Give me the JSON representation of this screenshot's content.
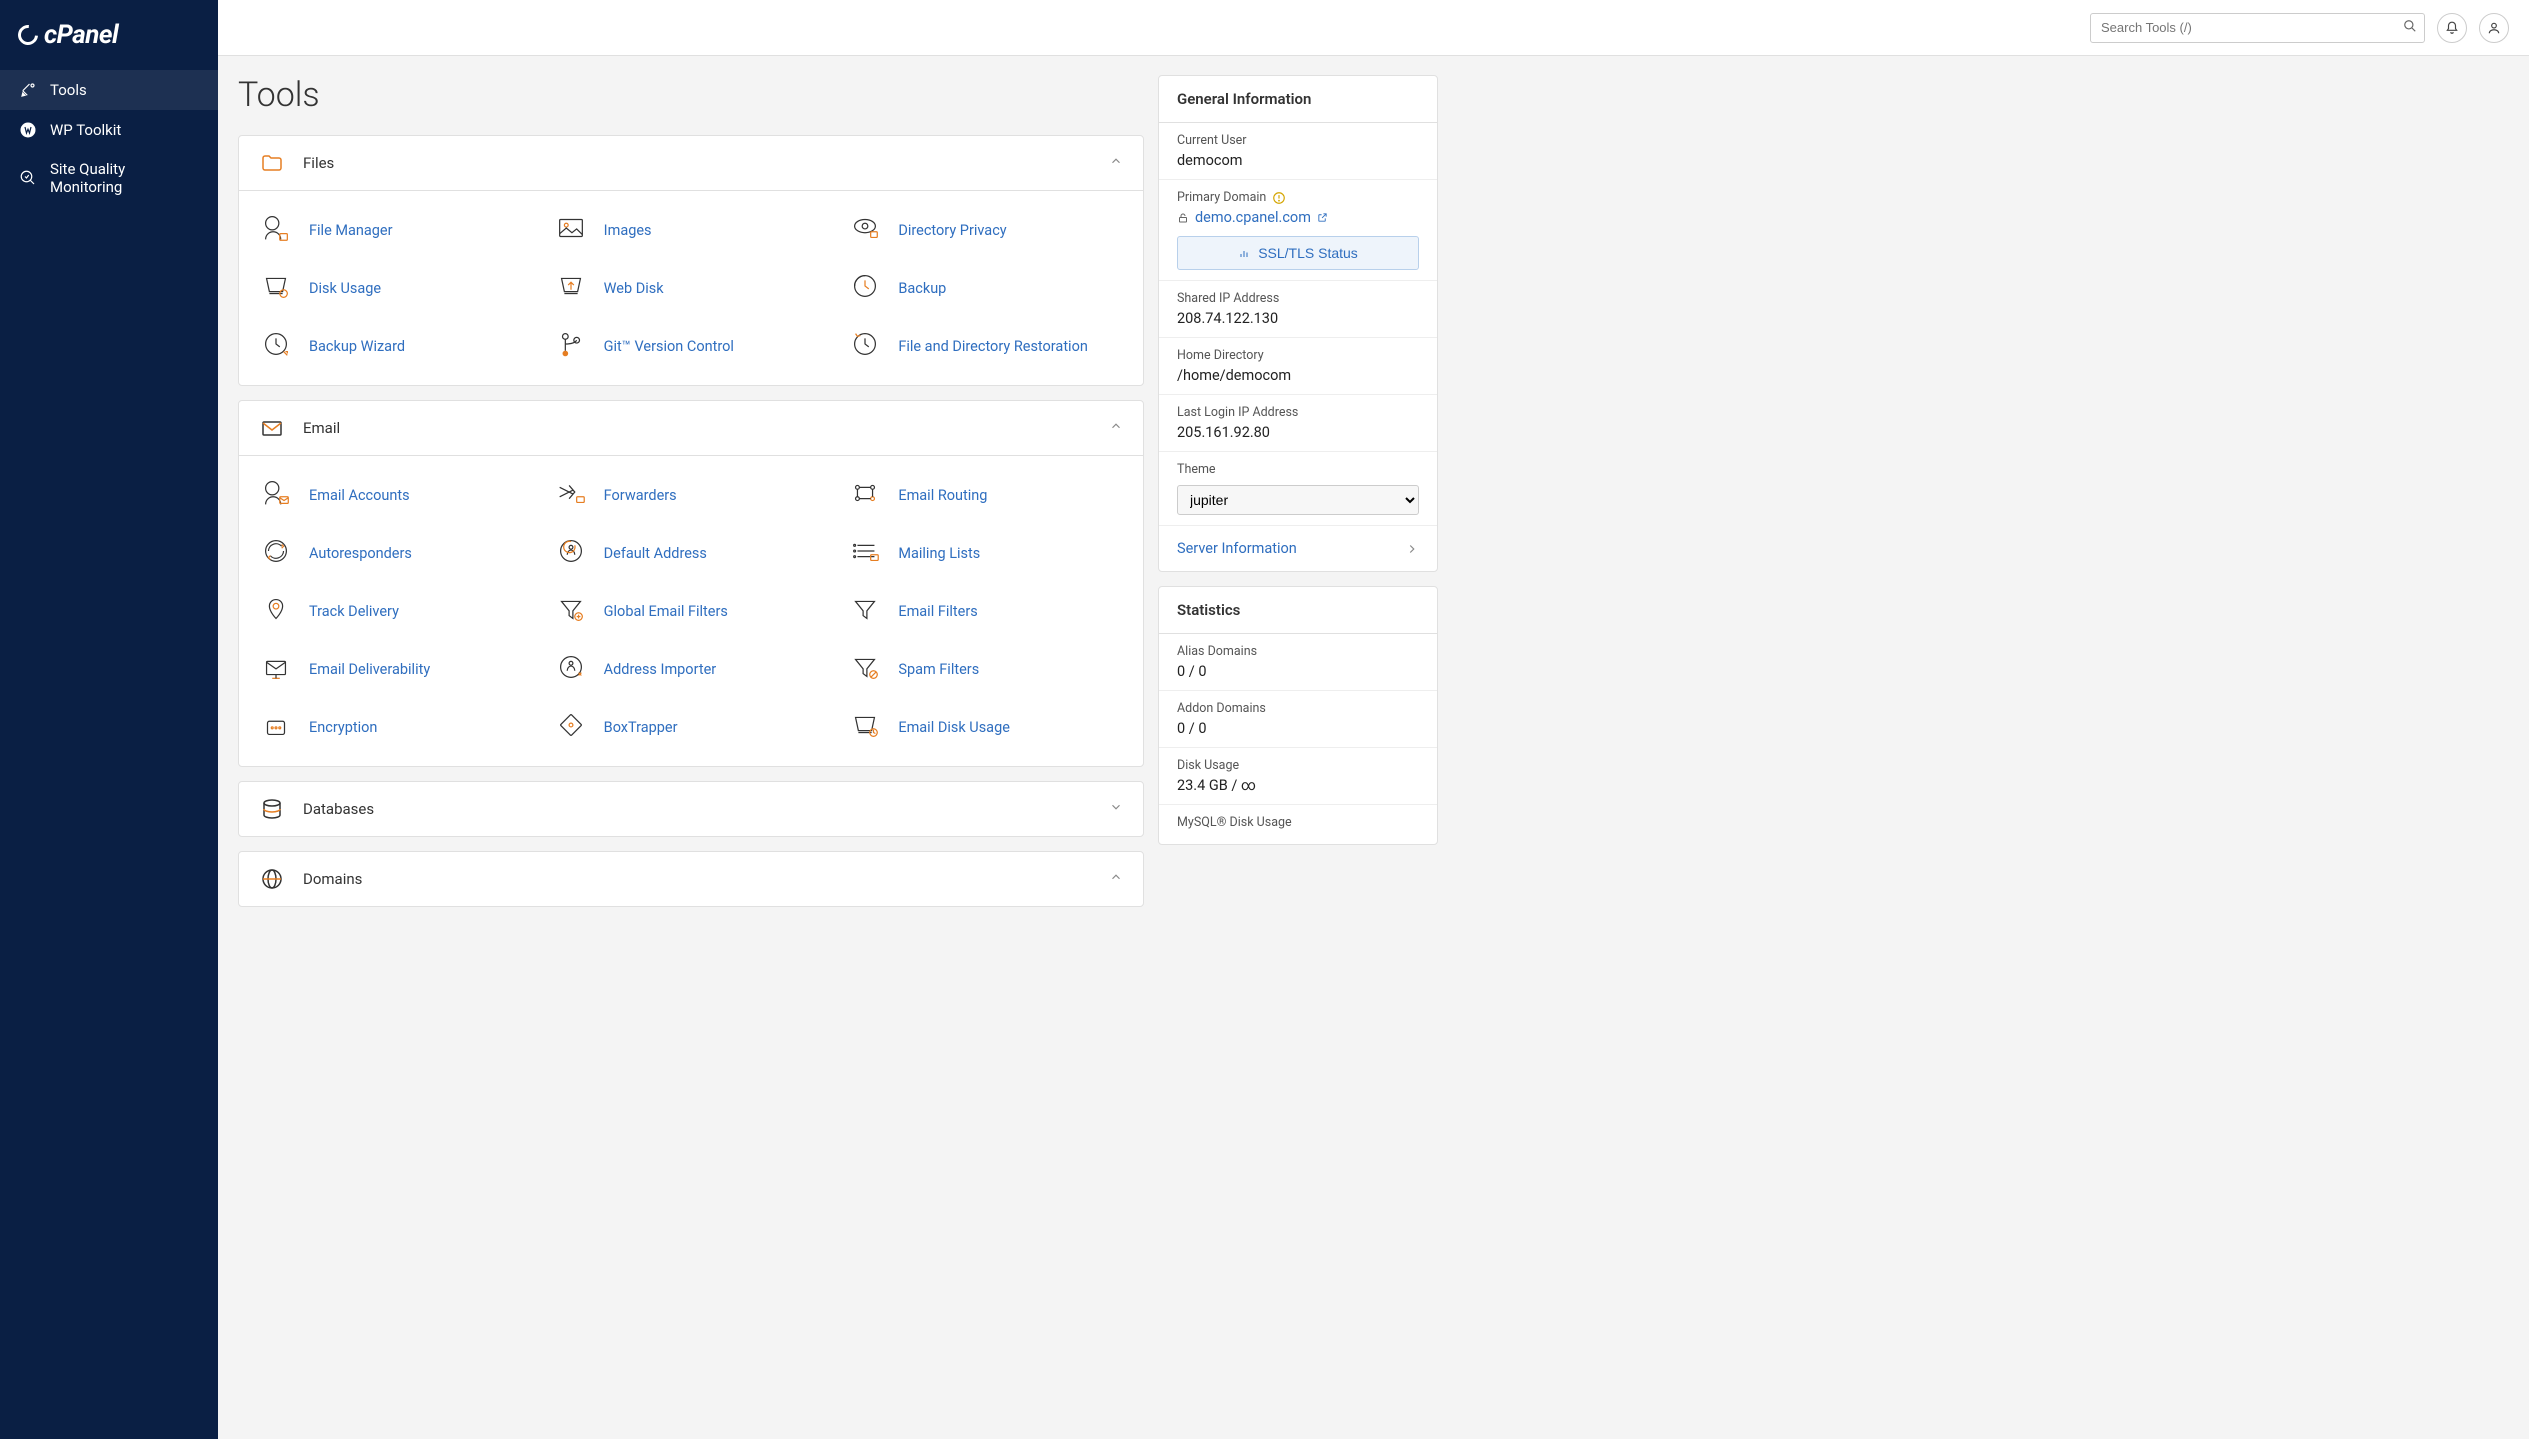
{
  "logo": "cPanel",
  "search": {
    "placeholder": "Search Tools (/)"
  },
  "nav": [
    {
      "label": "Tools"
    },
    {
      "label": "WP Toolkit"
    },
    {
      "label": "Site Quality Monitoring"
    }
  ],
  "page_title": "Tools",
  "sections": [
    {
      "title": "Files",
      "expanded": true,
      "icon": "folder-icon",
      "items": [
        {
          "label": "File Manager",
          "icon": "file-manager-icon"
        },
        {
          "label": "Images",
          "icon": "images-icon"
        },
        {
          "label": "Directory Privacy",
          "icon": "directory-privacy-icon"
        },
        {
          "label": "Disk Usage",
          "icon": "disk-usage-icon"
        },
        {
          "label": "Web Disk",
          "icon": "web-disk-icon"
        },
        {
          "label": "Backup",
          "icon": "backup-icon"
        },
        {
          "label": "Backup Wizard",
          "icon": "backup-wizard-icon"
        },
        {
          "label": "Git™ Version Control",
          "icon": "git-icon"
        },
        {
          "label": "File and Directory Restoration",
          "icon": "restore-icon"
        }
      ]
    },
    {
      "title": "Email",
      "expanded": true,
      "icon": "email-icon",
      "items": [
        {
          "label": "Email Accounts",
          "icon": "email-accounts-icon"
        },
        {
          "label": "Forwarders",
          "icon": "forwarders-icon"
        },
        {
          "label": "Email Routing",
          "icon": "email-routing-icon"
        },
        {
          "label": "Autoresponders",
          "icon": "autoresponders-icon"
        },
        {
          "label": "Default Address",
          "icon": "default-address-icon"
        },
        {
          "label": "Mailing Lists",
          "icon": "mailing-lists-icon"
        },
        {
          "label": "Track Delivery",
          "icon": "track-delivery-icon"
        },
        {
          "label": "Global Email Filters",
          "icon": "global-filters-icon"
        },
        {
          "label": "Email Filters",
          "icon": "email-filters-icon"
        },
        {
          "label": "Email Deliverability",
          "icon": "deliverability-icon"
        },
        {
          "label": "Address Importer",
          "icon": "address-importer-icon"
        },
        {
          "label": "Spam Filters",
          "icon": "spam-filters-icon"
        },
        {
          "label": "Encryption",
          "icon": "encryption-icon"
        },
        {
          "label": "BoxTrapper",
          "icon": "boxtrapper-icon"
        },
        {
          "label": "Email Disk Usage",
          "icon": "email-disk-usage-icon"
        }
      ]
    },
    {
      "title": "Databases",
      "expanded": false,
      "icon": "databases-icon",
      "items": []
    },
    {
      "title": "Domains",
      "expanded": true,
      "icon": "domains-icon",
      "items": []
    }
  ],
  "general_info": {
    "title": "General Information",
    "current_user_label": "Current User",
    "current_user": "democom",
    "primary_domain_label": "Primary Domain",
    "primary_domain": "demo.cpanel.com",
    "ssl_status_label": "SSL/TLS Status",
    "shared_ip_label": "Shared IP Address",
    "shared_ip": "208.74.122.130",
    "home_dir_label": "Home Directory",
    "home_dir": "/home/democom",
    "last_login_label": "Last Login IP Address",
    "last_login": "205.161.92.80",
    "theme_label": "Theme",
    "theme_value": "jupiter",
    "server_info_label": "Server Information"
  },
  "statistics": {
    "title": "Statistics",
    "rows": [
      {
        "label": "Alias Domains",
        "value": "0 / 0"
      },
      {
        "label": "Addon Domains",
        "value": "0 / 0"
      },
      {
        "label": "Disk Usage",
        "value": "23.4 GB / ∞"
      },
      {
        "label": "MySQL® Disk Usage",
        "value": ""
      }
    ]
  }
}
